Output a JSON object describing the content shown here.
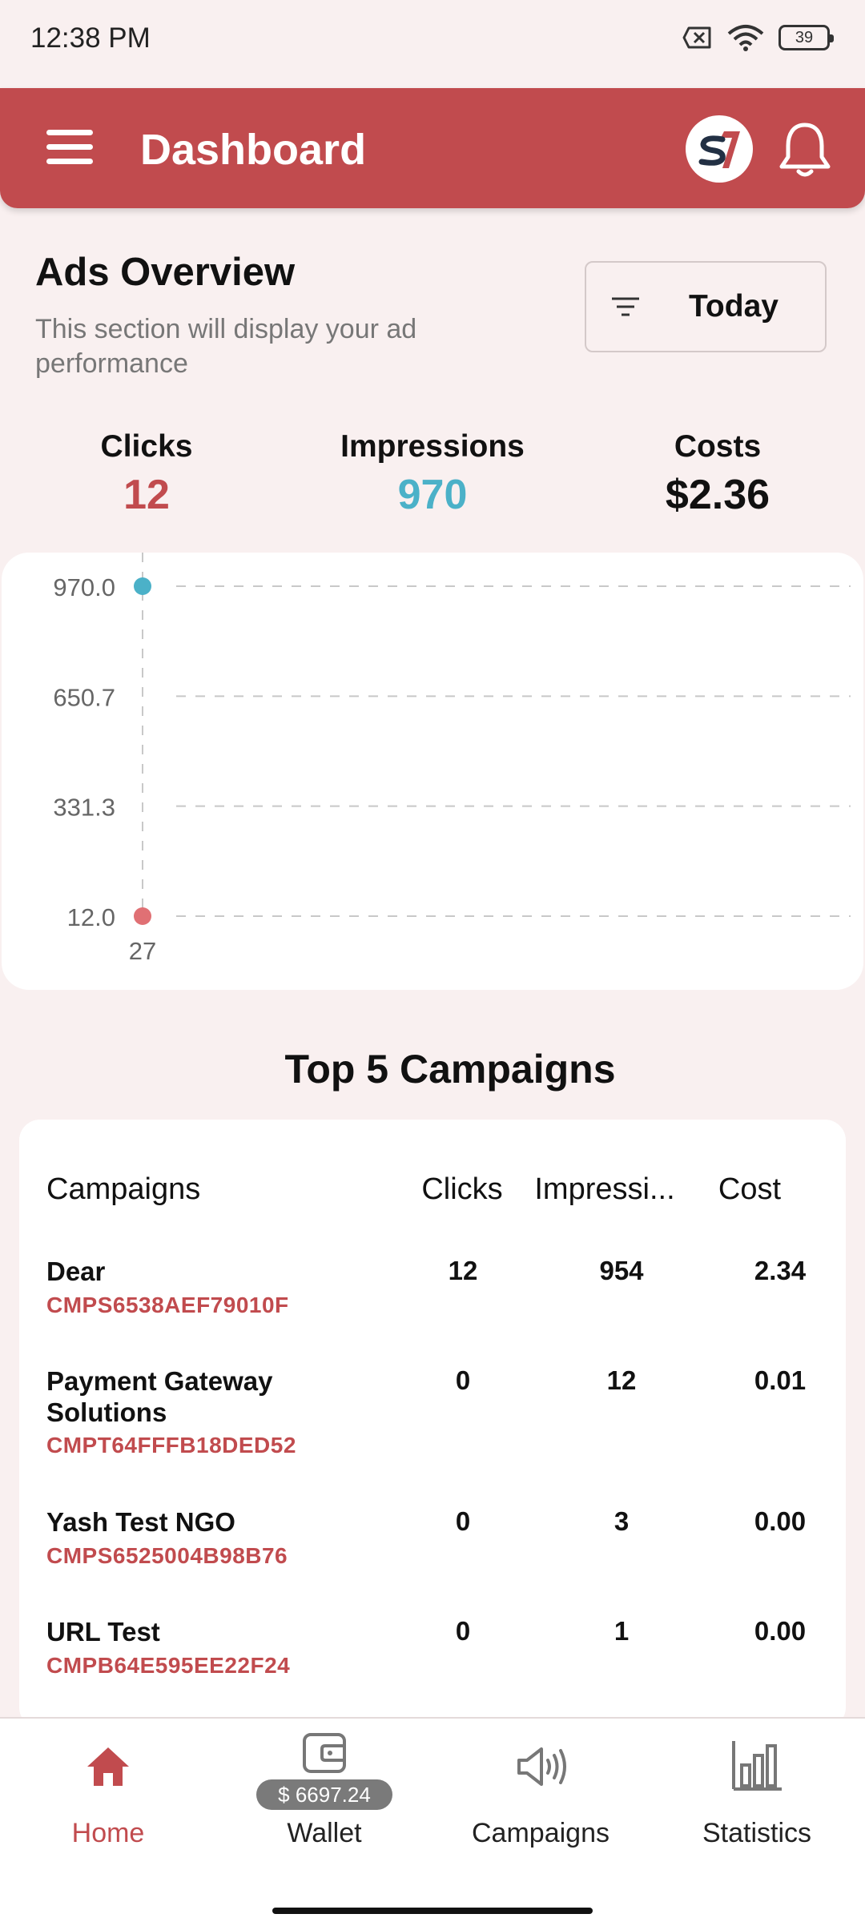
{
  "status_bar": {
    "time": "12:38 PM",
    "battery": "39"
  },
  "app_bar": {
    "title": "Dashboard",
    "menu_icon": "menu-icon",
    "logo_icon": "brand-logo-icon",
    "bell_icon": "bell-icon"
  },
  "overview": {
    "title": "Ads Overview",
    "subtitle": "This section will display your ad performance",
    "filter_label": "Today",
    "metrics": [
      {
        "label": "Clicks",
        "value": "12",
        "color": "#c14b4e"
      },
      {
        "label": "Impressions",
        "value": "970",
        "color": "#4bb1c8"
      },
      {
        "label": "Costs",
        "value": "$2.36",
        "color": "#111111"
      }
    ]
  },
  "chart_data": {
    "type": "scatter",
    "x": [
      27
    ],
    "x_tick_labels": [
      "27"
    ],
    "y_tick_labels": [
      "970.0",
      "650.7",
      "331.3",
      "12.0"
    ],
    "ylim": [
      12.0,
      970.0
    ],
    "grid": true,
    "series": [
      {
        "values": [
          970
        ],
        "color": "#4bb1c8"
      },
      {
        "values": [
          12
        ],
        "color": "#e07074"
      }
    ]
  },
  "top_campaigns": {
    "title": "Top 5 Campaigns",
    "columns": [
      "Campaigns",
      "Clicks",
      "Impressi...",
      "Cost"
    ],
    "rows": [
      {
        "name": "Dear",
        "id": "CMPS6538AEF79010F",
        "clicks": "12",
        "impressions": "954",
        "cost": "2.34"
      },
      {
        "name": "Payment Gateway Solutions",
        "id": "CMPT64FFFB18DED52",
        "clicks": "0",
        "impressions": "12",
        "cost": "0.01"
      },
      {
        "name": "Yash Test NGO",
        "id": "CMPS6525004B98B76",
        "clicks": "0",
        "impressions": "3",
        "cost": "0.00"
      },
      {
        "name": "URL Test",
        "id": "CMPB64E595EE22F24",
        "clicks": "0",
        "impressions": "1",
        "cost": "0.00"
      }
    ]
  },
  "bottom_nav": {
    "items": [
      {
        "label": "Home",
        "icon": "home-icon",
        "active": true
      },
      {
        "label": "Wallet",
        "icon": "wallet-icon",
        "active": false
      },
      {
        "label": "Campaigns",
        "icon": "megaphone-icon",
        "active": false
      },
      {
        "label": "Statistics",
        "icon": "bar-chart-icon",
        "active": false
      }
    ],
    "wallet_balance": "$ 6697.24"
  },
  "colors": {
    "primary": "#c14b4e",
    "accent": "#4bb1c8",
    "background": "#f9f0f0"
  }
}
